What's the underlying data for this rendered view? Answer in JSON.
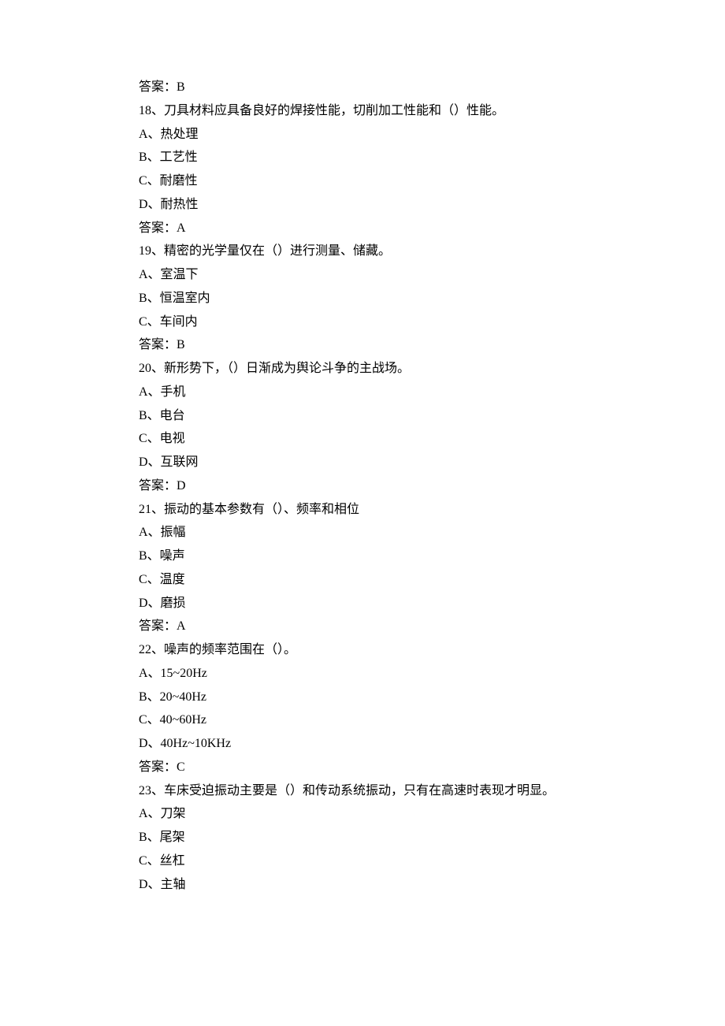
{
  "lines": [
    "答案：B",
    "18、刀具材料应具备良好的焊接性能，切削加工性能和（）性能。",
    "A、热处理",
    "B、工艺性",
    "C、耐磨性",
    "D、耐热性",
    "答案：A",
    "19、精密的光学量仅在（）进行测量、储藏。",
    "A、室温下",
    "B、恒温室内",
    "C、车间内",
    "答案：B",
    "20、新形势下，（）日渐成为舆论斗争的主战场。",
    "A、手机",
    "B、电台",
    "C、电视",
    "D、互联网",
    "答案：D",
    "21、振动的基本参数有（）、频率和相位",
    "A、振幅",
    "B、噪声",
    "C、温度",
    "D、磨损",
    "答案：A",
    "22、噪声的频率范围在（）。",
    "A、15~20Hz",
    "B、20~40Hz",
    "C、40~60Hz",
    "D、40Hz~10KHz",
    "答案：C",
    "23、车床受迫振动主要是（）和传动系统振动，只有在高速时表现才明显。",
    "A、刀架",
    "B、尾架",
    "C、丝杠",
    "D、主轴"
  ]
}
